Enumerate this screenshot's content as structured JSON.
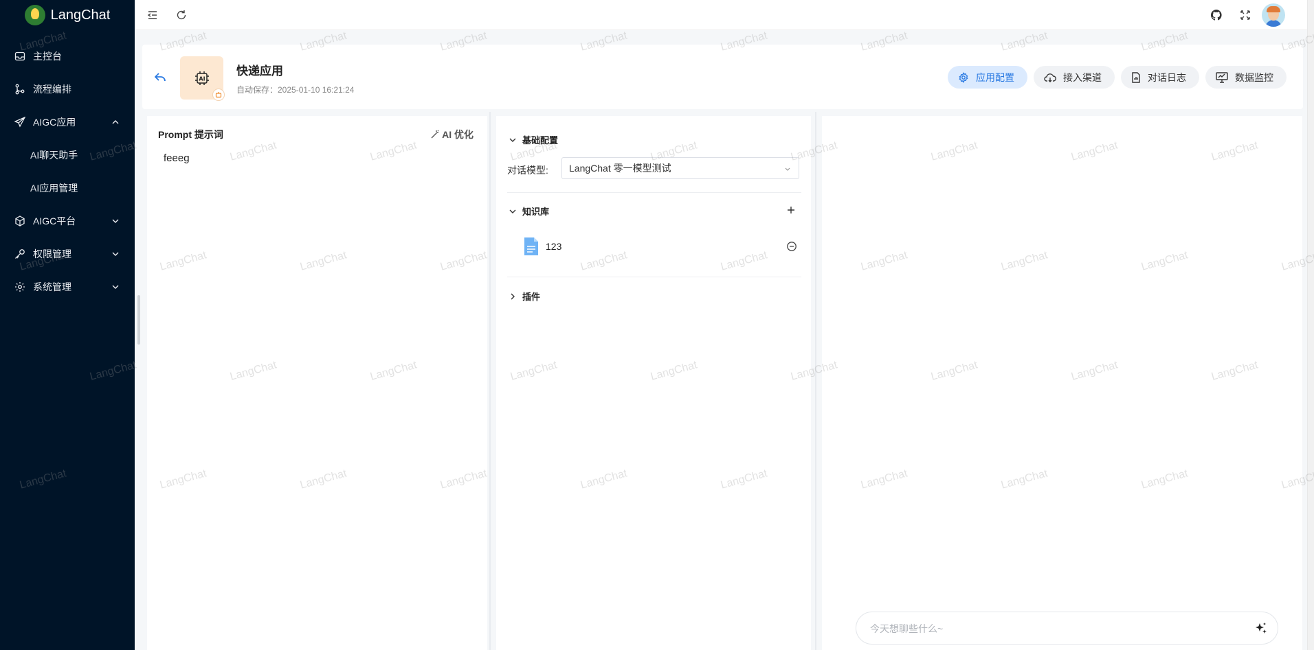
{
  "brand": {
    "name": "LangChat"
  },
  "sidebar": {
    "items": [
      {
        "label": "主控台",
        "icon": "inbox-icon"
      },
      {
        "label": "流程编排",
        "icon": "flow-icon"
      },
      {
        "label": "AIGC应用",
        "icon": "send-icon",
        "expanded": true,
        "children": [
          {
            "label": "AI聊天助手"
          },
          {
            "label": "AI应用管理"
          }
        ]
      },
      {
        "label": "AIGC平台",
        "icon": "cube-icon"
      },
      {
        "label": "权限管理",
        "icon": "key-icon"
      },
      {
        "label": "系统管理",
        "icon": "gear-icon"
      }
    ]
  },
  "app": {
    "name": "快递应用",
    "autosave": "自动保存：2025-01-10 16:21:24",
    "icon_text": "AI"
  },
  "tabs": [
    {
      "label": "应用配置",
      "icon": "gear-icon",
      "active": true
    },
    {
      "label": "接入渠道",
      "icon": "cloud-icon",
      "active": false
    },
    {
      "label": "对话日志",
      "icon": "document-icon",
      "active": false
    },
    {
      "label": "数据监控",
      "icon": "monitor-icon",
      "active": false
    }
  ],
  "prompt": {
    "title": "Prompt 提示词",
    "ai_optimize": "AI 优化",
    "text": "feeeg"
  },
  "config": {
    "basic": {
      "title": "基础配置",
      "model_label": "对话模型:",
      "model_value": "LangChat 零一模型测试"
    },
    "knowledge": {
      "title": "知识库",
      "items": [
        {
          "name": "123"
        }
      ]
    },
    "plugins": {
      "title": "插件"
    }
  },
  "chat": {
    "placeholder": "今天想聊些什么~"
  },
  "watermark": {
    "text": "LangChat"
  },
  "colors": {
    "sidebar_bg": "#001428",
    "accent": "#2a7ae2",
    "active_tab_bg": "#dbeafe"
  }
}
